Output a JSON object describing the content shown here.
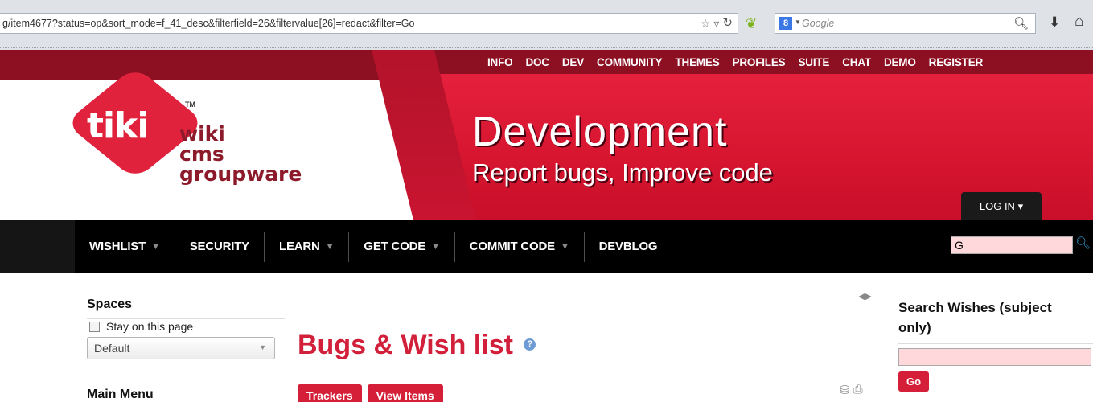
{
  "browser": {
    "url": "g/item4677?status=op&sort_mode=f_41_desc&filterfield=26&filtervalue[26]=redact&filter=Go",
    "search_engine_badge": "8",
    "search_placeholder": "Google",
    "icons": [
      "star-icon",
      "dropdown-icon",
      "reload-icon",
      "leaf-icon",
      "search-icon",
      "download-icon",
      "home-icon"
    ]
  },
  "top_nav": [
    "INFO",
    "DOC",
    "DEV",
    "COMMUNITY",
    "THEMES",
    "PROFILES",
    "SUITE",
    "CHAT",
    "DEMO",
    "REGISTER"
  ],
  "logo": {
    "mark": "tiki",
    "tm": "TM",
    "line1": "wiki",
    "line2": "cms",
    "line3": "groupware"
  },
  "banner": {
    "title": "Development",
    "subtitle": "Report bugs, Improve code"
  },
  "login": {
    "label": "LOG IN"
  },
  "main_nav": [
    {
      "label": "WISHLIST",
      "dropdown": true
    },
    {
      "label": "SECURITY",
      "dropdown": false
    },
    {
      "label": "LEARN",
      "dropdown": true
    },
    {
      "label": "GET CODE",
      "dropdown": true
    },
    {
      "label": "COMMIT CODE",
      "dropdown": true
    },
    {
      "label": "DEVBLOG",
      "dropdown": false
    }
  ],
  "nav_search": {
    "value": "G"
  },
  "spaces": {
    "title": "Spaces",
    "stay_label": "Stay on this page",
    "select_value": "Default"
  },
  "main_menu": {
    "title": "Main Menu"
  },
  "page": {
    "title": "Bugs & Wish list",
    "help_glyph": "?",
    "tabs": [
      "Trackers",
      "View Items"
    ]
  },
  "search_wishes": {
    "title_line1": "Search Wishes (subject",
    "title_line2": "only)",
    "go_label": "Go"
  },
  "colors": {
    "brand_red": "#d51e37",
    "dark_band": "#8c0f22",
    "nav_black": "#000000"
  }
}
